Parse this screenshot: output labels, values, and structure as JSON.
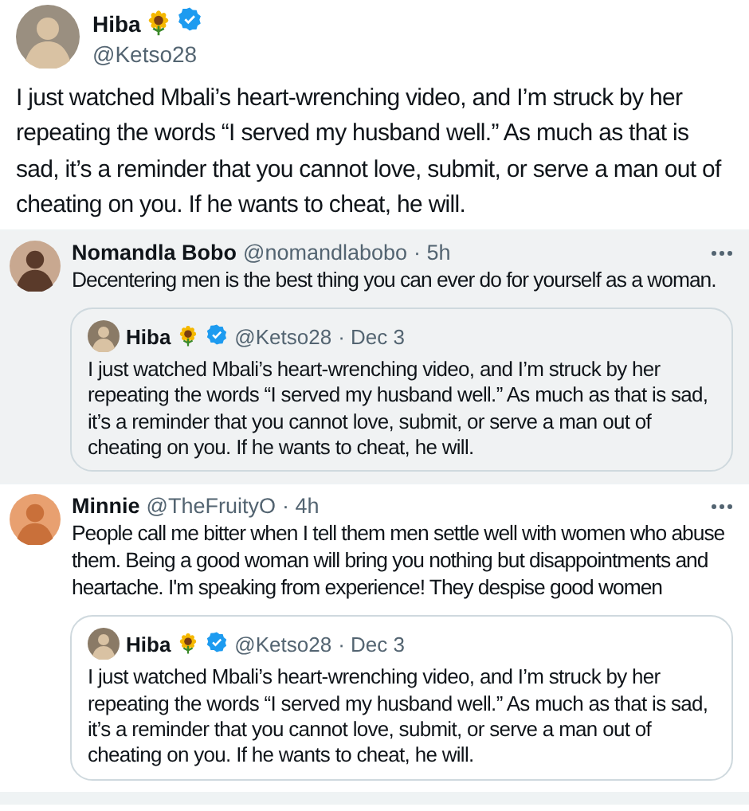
{
  "post": {
    "name": "Hiba",
    "handle": "@Ketso28",
    "verified": true,
    "text": "I just watched Mbali’s heart-wrenching video, and I’m struck by her repeating the words “I served my husband well.” As much as that is sad, it’s a reminder that you cannot love, submit, or serve a man out of cheating on you. If he wants to cheat, he will."
  },
  "replies": [
    {
      "name": "Nomandla Bobo",
      "handle": "@nomandlabobo",
      "time": "· 5h",
      "highlighted": true,
      "text": "Decentering men is the best thing you can ever do for yourself as a woman.",
      "quote": {
        "name": "Hiba",
        "handle": "@Ketso28",
        "time": "· Dec 3",
        "verified": true,
        "text": "I just watched Mbali’s heart-wrenching video, and I’m struck by her repeating the words “I served my husband well.” As much as that is sad, it’s a reminder that you cannot love, submit, or serve a man out of cheating on you. If he wants to cheat, he will."
      }
    },
    {
      "name": "Minnie",
      "handle": "@TheFruityO",
      "time": "· 4h",
      "highlighted": false,
      "text": "People call me bitter when I tell them men settle well with women who abuse them. Being a good woman will bring you nothing but disappointments and heartache. I'm speaking from experience! They despise good women",
      "quote": {
        "name": "Hiba",
        "handle": "@Ketso28",
        "time": "· Dec 3",
        "verified": true,
        "text": "I just watched Mbali’s heart-wrenching video, and I’m struck by her repeating the words “I served my husband well.” As much as that is sad, it’s a reminder that you cannot love, submit, or serve a man out of cheating on you. If he wants to cheat, he will."
      }
    }
  ]
}
